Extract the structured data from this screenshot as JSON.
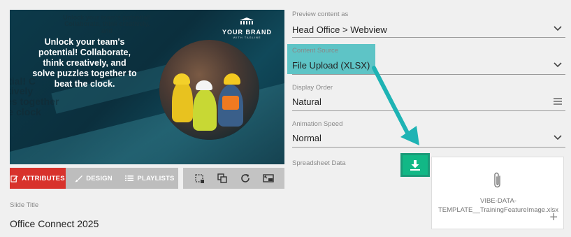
{
  "preview": {
    "ghost_top": "Unlock your team's potential! Collaborate, think creatively, and",
    "headline": "Unlock your team's potential! Collaborate, think creatively, and solve puzzles together to beat the clock.",
    "ghost_left": "ock y\npotential! C\nt creatively\npuzzles together\neat the clock",
    "brand_name": "YOUR BRAND",
    "brand_tag": "WITH TAGLINE"
  },
  "tabs": [
    {
      "label": "ATTRIBUTES",
      "icon": "edit-icon"
    },
    {
      "label": "DESIGN",
      "icon": "brush-icon"
    },
    {
      "label": "PLAYLISTS",
      "icon": "list-icon"
    }
  ],
  "tools": [
    "crop-icon",
    "layers-icon",
    "refresh-icon",
    "screen-icon"
  ],
  "slide_title": {
    "label": "Slide Title",
    "value": "Office Connect 2025"
  },
  "form": {
    "preview_as": {
      "label": "Preview content as",
      "value": "Head Office > Webview"
    },
    "content_source": {
      "label": "Content Source",
      "value": "File Upload (XLSX)"
    },
    "display_order": {
      "label": "Display Order",
      "value": "Natural"
    },
    "animation_speed": {
      "label": "Animation Speed",
      "value": "Normal"
    },
    "spreadsheet": {
      "label": "Spreadsheet Data",
      "file_name": "VIBE-DATA-TEMPLATE__TrainingFeatureImage.xlsx"
    }
  },
  "colors": {
    "accent_red": "#d8322c",
    "highlight_teal": "#5ec4c6",
    "arrow_teal": "#1eb3b4",
    "download_green": "#12b886"
  }
}
